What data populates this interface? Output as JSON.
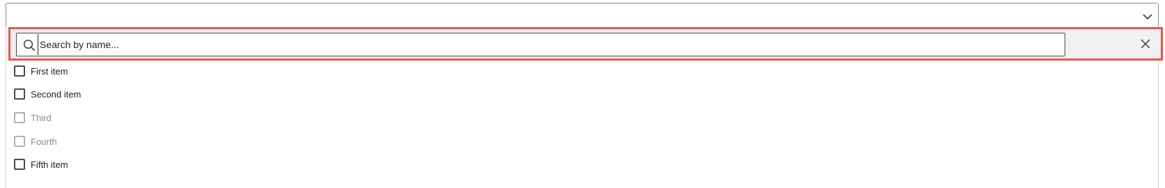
{
  "select": {
    "value": ""
  },
  "search": {
    "value": "",
    "placeholder": "Search by name..."
  },
  "items": [
    {
      "label": "First item",
      "checked": false,
      "disabled": false
    },
    {
      "label": "Second item",
      "checked": false,
      "disabled": false
    },
    {
      "label": "Third",
      "checked": false,
      "disabled": true
    },
    {
      "label": "Fourth",
      "checked": false,
      "disabled": true
    },
    {
      "label": "Fifth item",
      "checked": false,
      "disabled": false
    }
  ],
  "colors": {
    "highlight_border": "#e5584c",
    "search_row_bg": "#f1f1f1",
    "disabled_text": "#8a8a8a"
  },
  "icons": {
    "toggle": "chevron-down-icon",
    "search": "search-icon",
    "clear": "close-icon"
  }
}
